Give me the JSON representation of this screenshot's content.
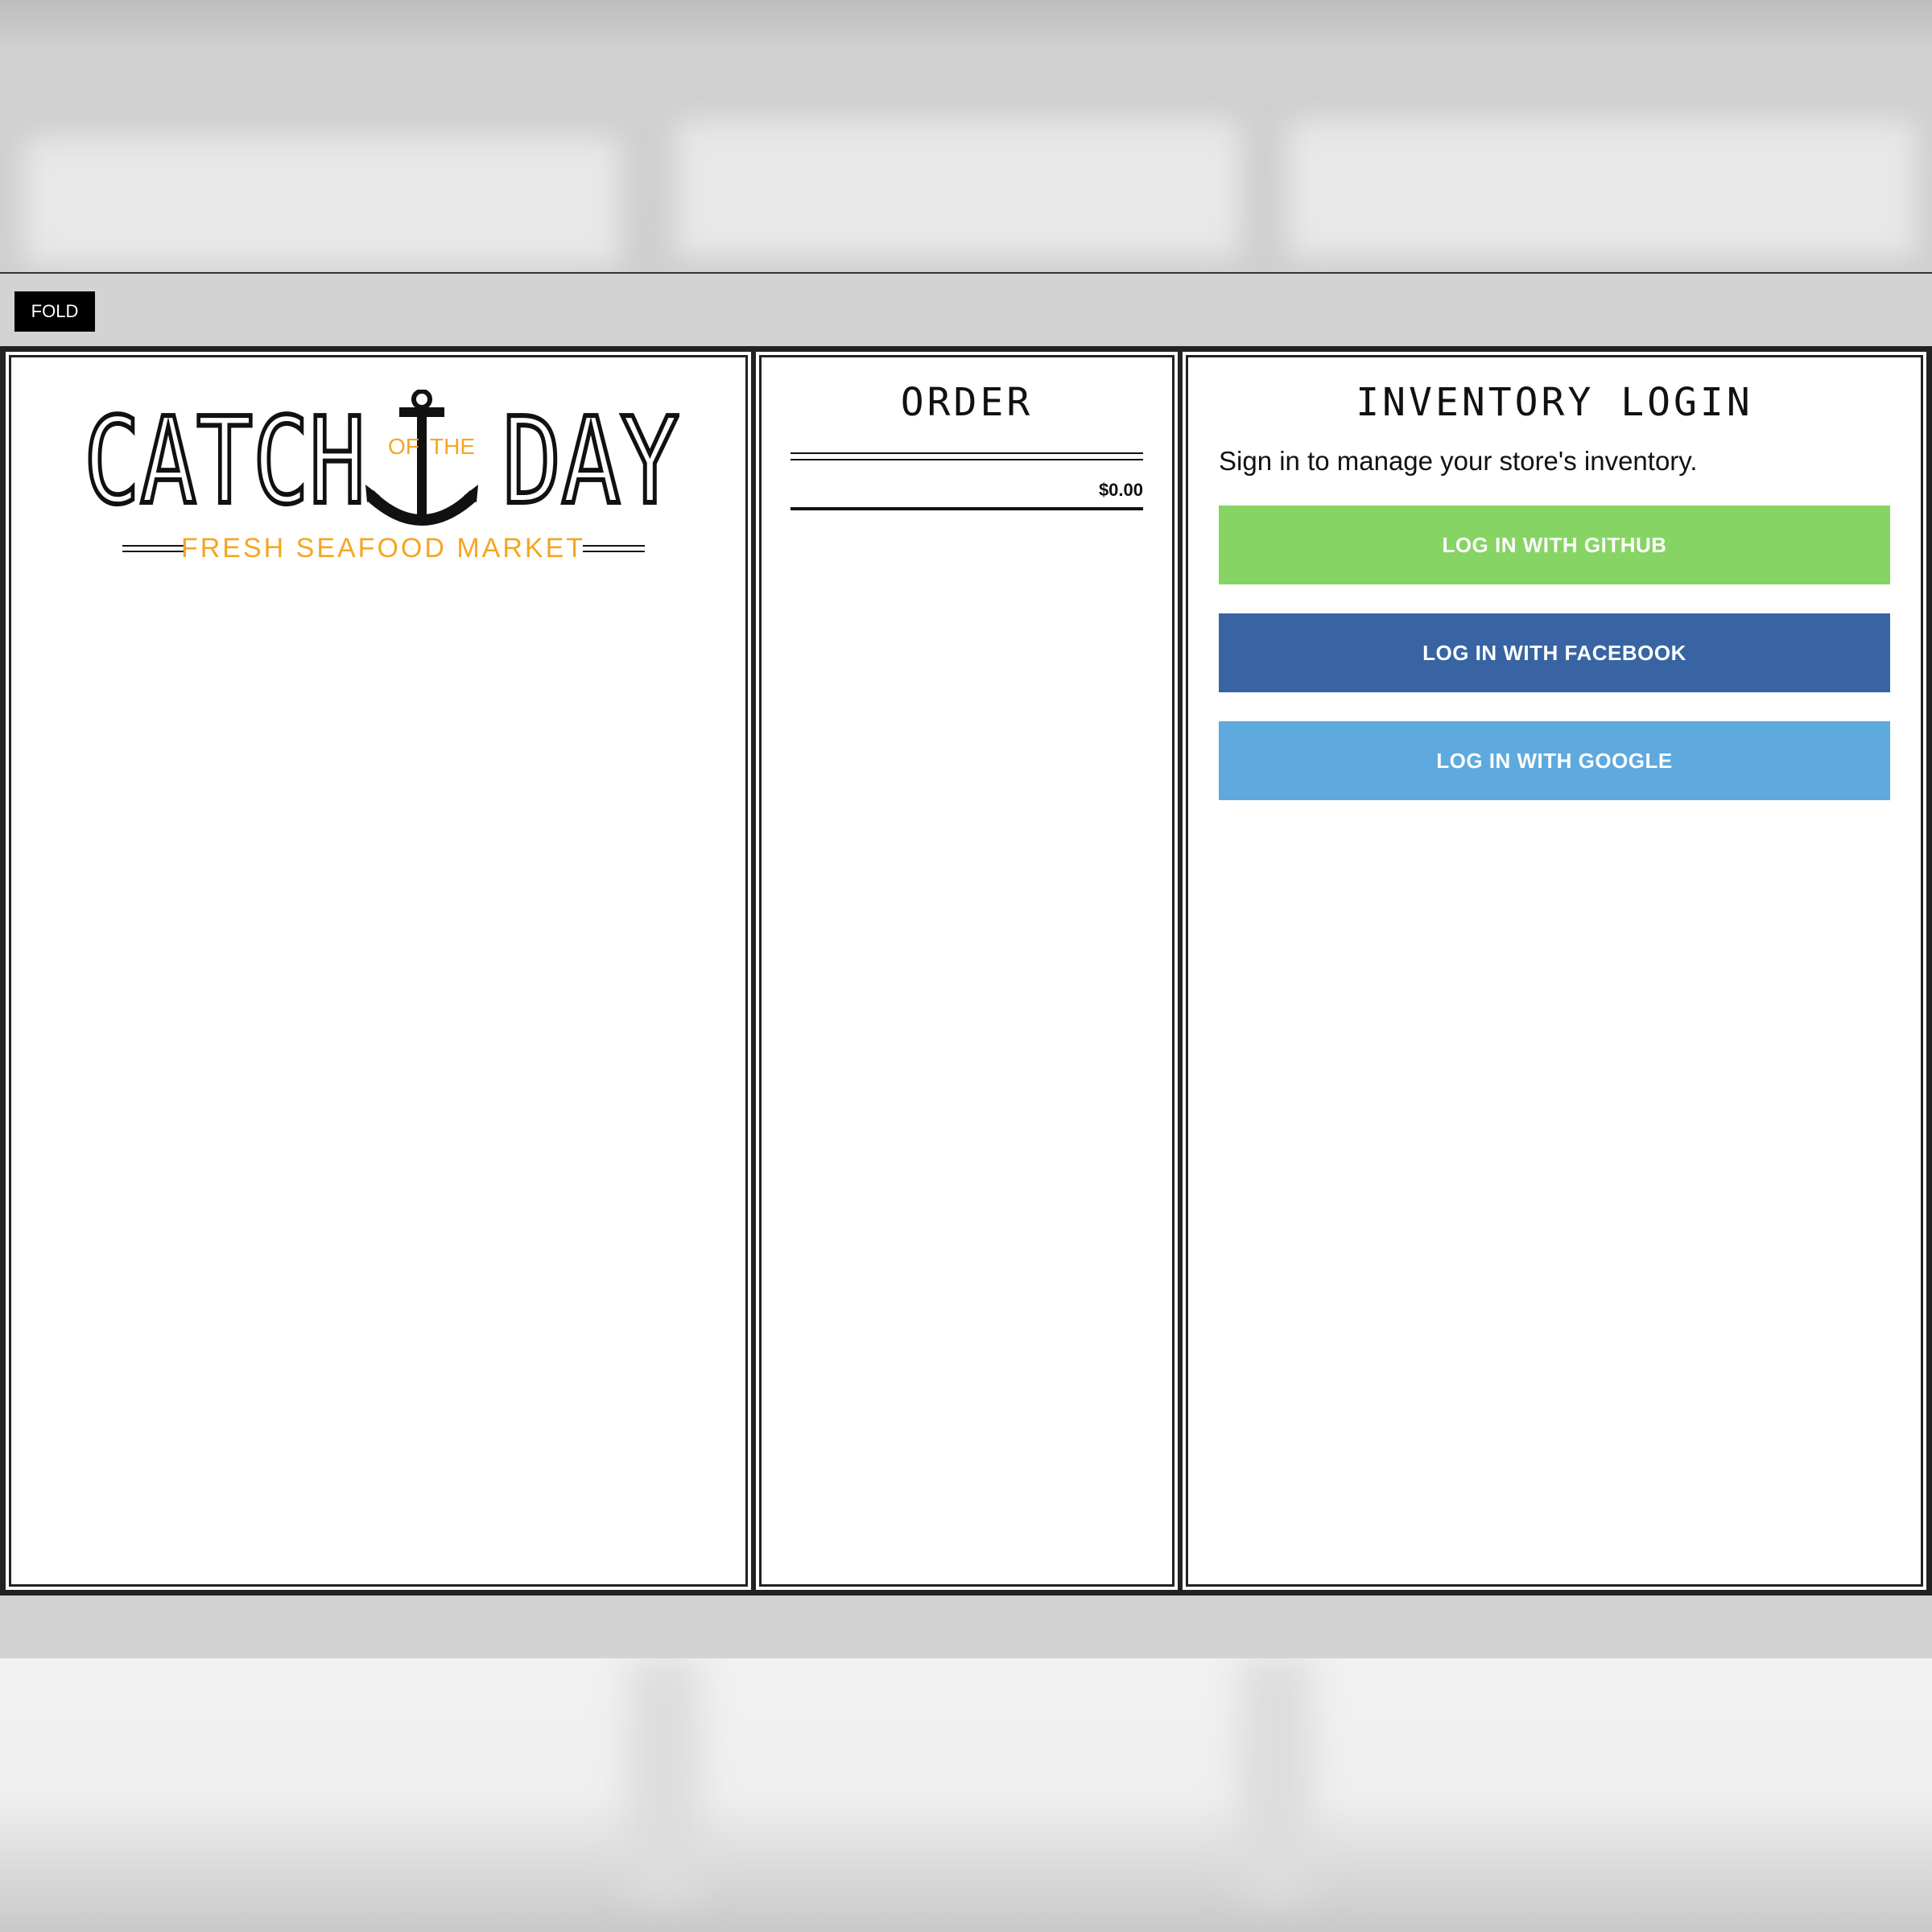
{
  "toolbar": {
    "fold_label": "FOLD"
  },
  "logo": {
    "word_left": "CATCH",
    "word_of": "OF",
    "word_the": "THE",
    "word_right": "DAY",
    "tagline": "FRESH SEAFOOD MARKET",
    "tagline_color": "#f5a623"
  },
  "order": {
    "heading": "ORDER",
    "total": "$0.00"
  },
  "inventory": {
    "heading": "INVENTORY LOGIN",
    "description": "Sign in to manage your store's inventory.",
    "buttons": {
      "github": {
        "label": "LOG IN WITH GITHUB",
        "color": "#86d463"
      },
      "facebook": {
        "label": "LOG IN WITH FACEBOOK",
        "color": "#3864a3"
      },
      "google": {
        "label": "LOG IN WITH GOOGLE",
        "color": "#5ea9dd"
      }
    }
  }
}
